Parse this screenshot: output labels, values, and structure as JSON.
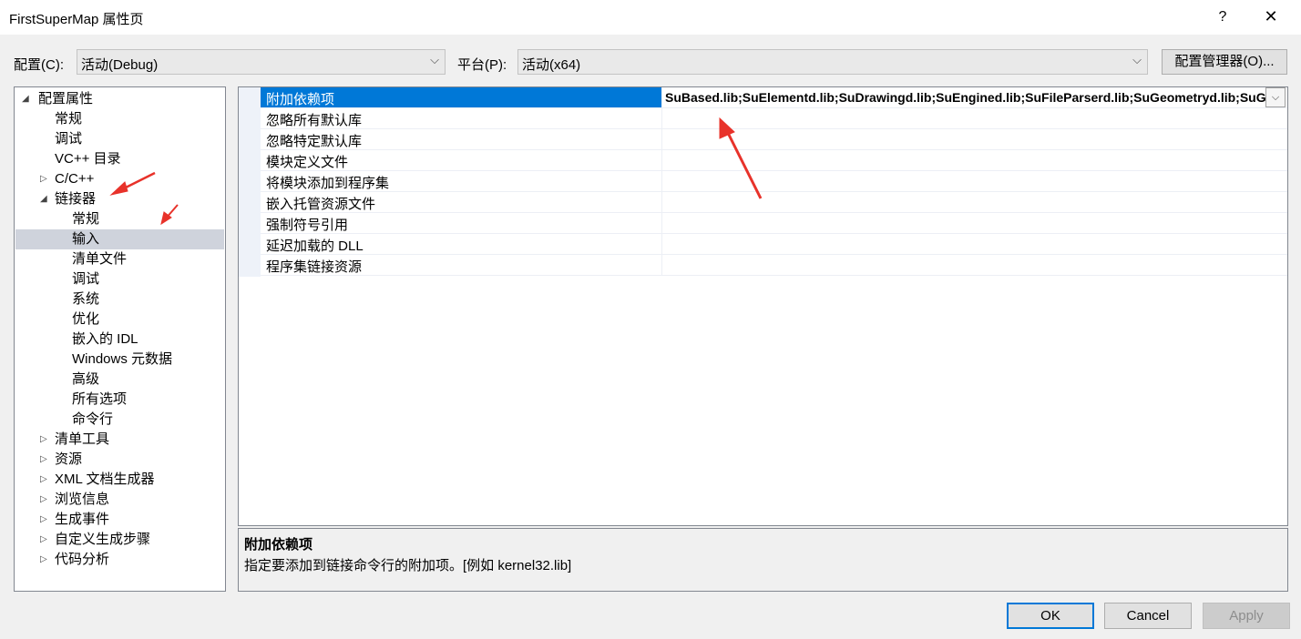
{
  "window": {
    "title": "FirstSuperMap 属性页",
    "help_glyph": "?",
    "close_glyph": "✕"
  },
  "config_bar": {
    "config_label": "配置(C):",
    "config_value": "活动(Debug)",
    "platform_label": "平台(P):",
    "platform_value": "活动(x64)",
    "manager_button": "配置管理器(O)..."
  },
  "tree": {
    "items": [
      {
        "label": "配置属性",
        "toggle": "◢"
      },
      {
        "label": "常规",
        "toggle": ""
      },
      {
        "label": "调试",
        "toggle": ""
      },
      {
        "label": "VC++ 目录",
        "toggle": ""
      },
      {
        "label": "C/C++",
        "toggle": "▷"
      },
      {
        "label": "链接器",
        "toggle": "◢"
      },
      {
        "label": "常规",
        "toggle": ""
      },
      {
        "label": "输入",
        "toggle": ""
      },
      {
        "label": "清单文件",
        "toggle": ""
      },
      {
        "label": "调试",
        "toggle": ""
      },
      {
        "label": "系统",
        "toggle": ""
      },
      {
        "label": "优化",
        "toggle": ""
      },
      {
        "label": "嵌入的 IDL",
        "toggle": ""
      },
      {
        "label": "Windows 元数据",
        "toggle": ""
      },
      {
        "label": "高级",
        "toggle": ""
      },
      {
        "label": "所有选项",
        "toggle": ""
      },
      {
        "label": "命令行",
        "toggle": ""
      },
      {
        "label": "清单工具",
        "toggle": "▷"
      },
      {
        "label": "资源",
        "toggle": "▷"
      },
      {
        "label": "XML 文档生成器",
        "toggle": "▷"
      },
      {
        "label": "浏览信息",
        "toggle": "▷"
      },
      {
        "label": "生成事件",
        "toggle": "▷"
      },
      {
        "label": "自定义生成步骤",
        "toggle": "▷"
      },
      {
        "label": "代码分析",
        "toggle": "▷"
      }
    ]
  },
  "properties": {
    "rows": [
      {
        "name": "附加依赖项",
        "value": "SuBased.lib;SuElementd.lib;SuDrawingd.lib;SuEngined.lib;SuFileParserd.lib;SuGeometryd.lib;SuG"
      },
      {
        "name": "忽略所有默认库",
        "value": ""
      },
      {
        "name": "忽略特定默认库",
        "value": ""
      },
      {
        "name": "模块定义文件",
        "value": ""
      },
      {
        "name": "将模块添加到程序集",
        "value": ""
      },
      {
        "name": "嵌入托管资源文件",
        "value": ""
      },
      {
        "name": "强制符号引用",
        "value": ""
      },
      {
        "name": "延迟加载的 DLL",
        "value": ""
      },
      {
        "name": "程序集链接资源",
        "value": ""
      }
    ],
    "dropdown_glyph": "⌵"
  },
  "description": {
    "title": "附加依赖项",
    "text": "指定要添加到链接命令行的附加项。[例如 kernel32.lib]"
  },
  "buttons": {
    "ok": "OK",
    "cancel": "Cancel",
    "apply": "Apply"
  },
  "colors": {
    "selection_blue": "#0078d7",
    "annotation_red": "#e8322a"
  }
}
